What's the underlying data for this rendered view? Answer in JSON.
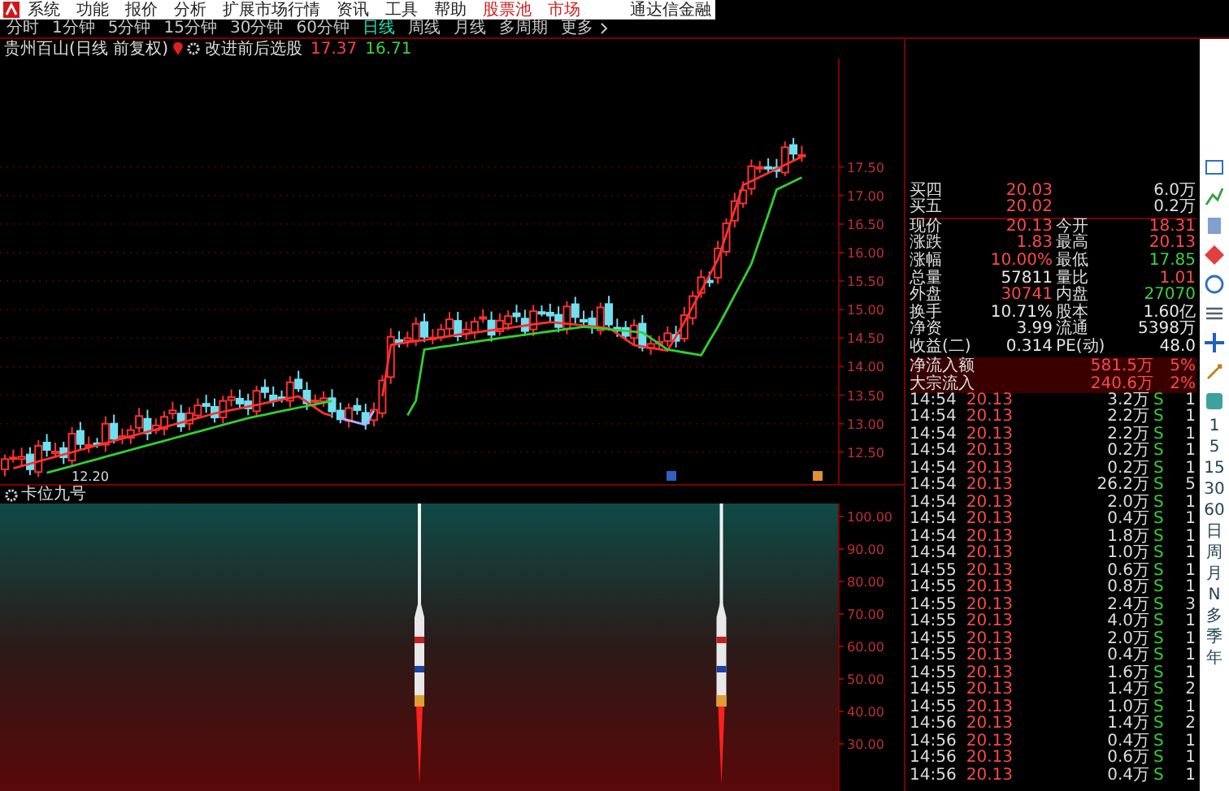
{
  "menu": {
    "items": [
      {
        "label": "系统",
        "highlighted": false
      },
      {
        "label": "功能",
        "highlighted": false
      },
      {
        "label": "报价",
        "highlighted": false
      },
      {
        "label": "分析",
        "highlighted": false
      },
      {
        "label": "扩展市场行情",
        "highlighted": false
      },
      {
        "label": "资讯",
        "highlighted": false
      },
      {
        "label": "工具",
        "highlighted": false
      },
      {
        "label": "帮助",
        "highlighted": false
      },
      {
        "label": "股票池",
        "highlighted": true
      },
      {
        "label": "市场",
        "highlighted": true
      }
    ],
    "brand": "通达信金融"
  },
  "periods": [
    {
      "label": "分时",
      "selected": false
    },
    {
      "label": "1分钟",
      "selected": false
    },
    {
      "label": "5分钟",
      "selected": false
    },
    {
      "label": "15分钟",
      "selected": false
    },
    {
      "label": "30分钟",
      "selected": false
    },
    {
      "label": "60分钟",
      "selected": false
    },
    {
      "label": "日线",
      "selected": true
    },
    {
      "label": "周线",
      "selected": false
    },
    {
      "label": "月线",
      "selected": false
    },
    {
      "label": "多周期",
      "selected": false
    },
    {
      "label": "更多",
      "selected": false
    }
  ],
  "chart_title": {
    "name": "贵州百山(日线 前复权)",
    "indicator": "改进前后选股",
    "values": [
      {
        "text": "17.37",
        "color": "#ff4040"
      },
      {
        "text": "16.71",
        "color": "#40d040"
      }
    ]
  },
  "price_axis": [
    "17.50",
    "17.00",
    "16.50",
    "16.00",
    "15.50",
    "15.00",
    "14.50",
    "14.00",
    "13.50",
    "13.00",
    "12.50"
  ],
  "low_label": "12.20",
  "indicator_panel": {
    "title": "卡位九号",
    "axis": [
      "100.00",
      "90.00",
      "80.00",
      "70.00",
      "60.00",
      "50.00",
      "40.00",
      "30.00"
    ]
  },
  "quote": {
    "asks": [
      {
        "label": "买四",
        "price": "20.03",
        "volume": "6.0万"
      },
      {
        "label": "买五",
        "price": "20.02",
        "volume": "0.2万"
      }
    ],
    "rows": [
      {
        "cells": [
          {
            "text": "现价"
          },
          {
            "text": "20.13",
            "color": "#ff4848"
          },
          {
            "text": "今开"
          },
          {
            "text": "18.31",
            "color": "#ff4848"
          }
        ]
      },
      {
        "cells": [
          {
            "text": "涨跌"
          },
          {
            "text": "1.83",
            "color": "#ff4848"
          },
          {
            "text": "最高"
          },
          {
            "text": "20.13",
            "color": "#ff4848"
          }
        ]
      },
      {
        "cells": [
          {
            "text": "涨幅"
          },
          {
            "text": "10.00%",
            "color": "#ff4848"
          },
          {
            "text": "最低"
          },
          {
            "text": "17.85",
            "color": "#40d040"
          }
        ]
      },
      {
        "cells": [
          {
            "text": "总量"
          },
          {
            "text": "57811",
            "color": "#e8e8e8"
          },
          {
            "text": "量比"
          },
          {
            "text": "1.01",
            "color": "#ff4848"
          }
        ]
      },
      {
        "cells": [
          {
            "text": "外盘"
          },
          {
            "text": "30741",
            "color": "#ff4848"
          },
          {
            "text": "内盘"
          },
          {
            "text": "27070",
            "color": "#40d040"
          }
        ]
      },
      {
        "cells": [
          {
            "text": "换手"
          },
          {
            "text": "10.71%",
            "color": "#e8e8e8"
          },
          {
            "text": "股本"
          },
          {
            "text": "1.60亿",
            "color": "#e8e8e8"
          }
        ]
      },
      {
        "cells": [
          {
            "text": "净资"
          },
          {
            "text": "3.99",
            "color": "#e8e8e8"
          },
          {
            "text": "流通"
          },
          {
            "text": "5398万",
            "color": "#e8e8e8"
          }
        ]
      },
      {
        "cells": [
          {
            "text": "收益(二)"
          },
          {
            "text": "0.314",
            "color": "#e8e8e8"
          },
          {
            "text": "PE(动)"
          },
          {
            "text": "48.0",
            "color": "#e8e8e8"
          }
        ]
      }
    ],
    "flows": [
      {
        "label": "净流入额",
        "value": "581.5万",
        "share": "5%"
      },
      {
        "label": "大宗流入",
        "value": "240.6万",
        "share": "2%"
      }
    ]
  },
  "trades": [
    {
      "time": "14:54",
      "price": "20.13",
      "volume": "3.2万",
      "side": "S",
      "count": "1"
    },
    {
      "time": "14:54",
      "price": "20.13",
      "volume": "2.2万",
      "side": "S",
      "count": "1"
    },
    {
      "time": "14:54",
      "price": "20.13",
      "volume": "2.2万",
      "side": "S",
      "count": "1"
    },
    {
      "time": "14:54",
      "price": "20.13",
      "volume": "0.2万",
      "side": "S",
      "count": "1"
    },
    {
      "time": "14:54",
      "price": "20.13",
      "volume": "0.2万",
      "side": "S",
      "count": "1"
    },
    {
      "time": "14:54",
      "price": "20.13",
      "volume": "26.2万",
      "side": "S",
      "count": "5"
    },
    {
      "time": "14:54",
      "price": "20.13",
      "volume": "2.0万",
      "side": "S",
      "count": "1"
    },
    {
      "time": "14:54",
      "price": "20.13",
      "volume": "0.4万",
      "side": "S",
      "count": "1"
    },
    {
      "time": "14:54",
      "price": "20.13",
      "volume": "1.8万",
      "side": "S",
      "count": "1"
    },
    {
      "time": "14:54",
      "price": "20.13",
      "volume": "1.0万",
      "side": "S",
      "count": "1"
    },
    {
      "time": "14:55",
      "price": "20.13",
      "volume": "0.6万",
      "side": "S",
      "count": "1"
    },
    {
      "time": "14:55",
      "price": "20.13",
      "volume": "0.8万",
      "side": "S",
      "count": "1"
    },
    {
      "time": "14:55",
      "price": "20.13",
      "volume": "2.4万",
      "side": "S",
      "count": "3"
    },
    {
      "time": "14:55",
      "price": "20.13",
      "volume": "4.0万",
      "side": "S",
      "count": "1"
    },
    {
      "time": "14:55",
      "price": "20.13",
      "volume": "2.0万",
      "side": "S",
      "count": "1"
    },
    {
      "time": "14:55",
      "price": "20.13",
      "volume": "0.4万",
      "side": "S",
      "count": "1"
    },
    {
      "time": "14:55",
      "price": "20.13",
      "volume": "1.6万",
      "side": "S",
      "count": "1"
    },
    {
      "time": "14:55",
      "price": "20.13",
      "volume": "1.4万",
      "side": "S",
      "count": "2"
    },
    {
      "time": "14:55",
      "price": "20.13",
      "volume": "1.0万",
      "side": "S",
      "count": "1"
    },
    {
      "time": "14:56",
      "price": "20.13",
      "volume": "1.4万",
      "side": "S",
      "count": "2"
    },
    {
      "time": "14:56",
      "price": "20.13",
      "volume": "0.4万",
      "side": "S",
      "count": "1"
    },
    {
      "time": "14:56",
      "price": "20.13",
      "volume": "0.6万",
      "side": "S",
      "count": "1"
    },
    {
      "time": "14:56",
      "price": "20.13",
      "volume": "0.4万",
      "side": "S",
      "count": "1"
    }
  ],
  "side_strip": [
    "1",
    "5",
    "15",
    "30",
    "60",
    "日",
    "周",
    "月",
    "N",
    "多",
    "季",
    "年"
  ]
}
